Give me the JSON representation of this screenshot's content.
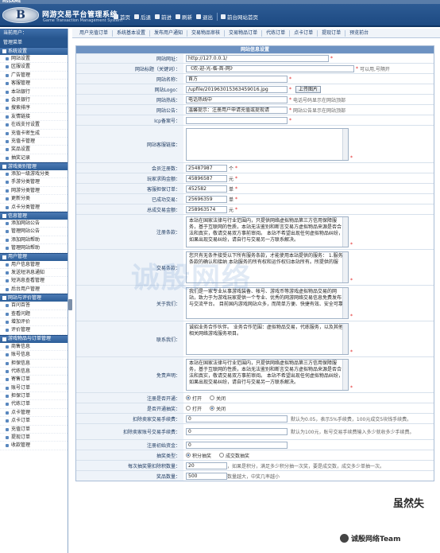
{
  "window_title": "HSSAME",
  "header": {
    "logo_text": "B",
    "system_name": "网游交易平台管理系统",
    "system_name_en": "Game Transaction Management System",
    "nav": [
      {
        "label": "首页",
        "icon": "home-icon"
      },
      {
        "label": "后退",
        "icon": "back-icon"
      },
      {
        "label": "前进",
        "icon": "forward-icon"
      },
      {
        "label": "刷新",
        "icon": "refresh-icon"
      },
      {
        "label": "退出",
        "icon": "logout-icon"
      },
      {
        "label": "前台网站首页",
        "icon": "site-home-icon"
      }
    ]
  },
  "sidebar": {
    "current_user_label": "当前用户：",
    "admin_label": "管理菜单",
    "groups": [
      {
        "title": "系统设置",
        "items": [
          "网站设置",
          "区服设置",
          "广告管理",
          "客服管理",
          "本站银行",
          "会员银行",
          "搜索排序",
          "友情链接",
          "在线支付设置",
          "充值卡密生成",
          "充值卡管理",
          "奖品设置",
          "抽奖记录"
        ]
      },
      {
        "title": "游戏类别管理",
        "items": [
          "添加一级游戏分类",
          "手游分类管理",
          "网游分类管理",
          "更新分类",
          "点卡分类管理"
        ]
      },
      {
        "title": "信息管理",
        "items": [
          "添加网站公告",
          "管理网站公告",
          "添加网站帮助",
          "管理网站帮助"
        ]
      },
      {
        "title": "用户管理",
        "items": [
          "用户信息管理",
          "发送短消息通知",
          "短消息查看管理",
          "后台用户管理"
        ]
      },
      {
        "title": "网站与评价管理",
        "items": [
          "百问百答",
          "查看问题",
          "增加评价",
          "评价管理"
        ]
      },
      {
        "title": "游戏物品与订单管理",
        "items": [
          "商售信息",
          "账号信息",
          "担保信息",
          "代练信息",
          "寄售订单",
          "账号订单",
          "担保订单",
          "代练订单",
          "点卡管理",
          "点卡订单",
          "充值订单",
          "提现订单",
          "收款管理"
        ]
      }
    ]
  },
  "tabs": [
    "用户充值订单",
    "系统基本设置",
    "发布用户通知",
    "交易物品审核",
    "交易物品订单",
    "代练订单",
    "点卡订单",
    "提现订单",
    "预览前台"
  ],
  "form": {
    "title": "网站信息设置",
    "rows": [
      {
        "label": "网站网址：",
        "value": "http://127.0.0.1/",
        "required": true,
        "hint": ""
      },
      {
        "label": "网站标题（关键词）：",
        "value": "《欢-迎-光-临-首-网》",
        "required": true,
        "hint": "可以用,号隔开"
      },
      {
        "label": "网站名称：",
        "value": "首方",
        "required": true,
        "hint": ""
      },
      {
        "label": "网站Logo：",
        "value": "/upfile/201963015363459016.jpg",
        "required": true,
        "button": "上传图片"
      },
      {
        "label": "网站热线：",
        "value": "电话热线中",
        "required": true,
        "hint": "电话号码显示在网站顶部"
      },
      {
        "label": "网站公告：",
        "value": "温馨提示：注册用户申请充值或提现请",
        "required": true,
        "hint": "网站公告显示在网站顶部"
      },
      {
        "label": "Icp备案号：",
        "value": "",
        "required": true
      }
    ],
    "service_label": "网站客服链接：",
    "stats": [
      {
        "label": "会员注册数：",
        "value": "25487987",
        "unit": "个"
      },
      {
        "label": "玩家求购金额：",
        "value": "45896587",
        "unit": "元"
      },
      {
        "label": "客服担保订单：",
        "value": "452582",
        "unit": "单"
      },
      {
        "label": "已成功交易：",
        "value": "25696359",
        "unit": "单"
      },
      {
        "label": "总成交易金额：",
        "value": "258963574",
        "unit": "元"
      }
    ],
    "texts": [
      {
        "label": "注册条款：",
        "content": "本站在国家法律与行业范围内，只提供网络虚拟物品第三方信用保障服务，基于互联网的性质，本站无法鉴别和断言交易方虚拟物品来源是否合法和真实，敬请交易双方事前审阅。  本站不希望出现任何虚拟物品纠纷，如果出现交易纠纷，请自行与交易另一方联系解决。"
      },
      {
        "label": "交易条款：",
        "content": "您只有无条件接受以下所有服务条款，才能使用本站提供的服务：  1.服务条款的确认和接纳  本站服务的所有权和运作权归本站所有。所提供的服"
      },
      {
        "label": "关于我们：",
        "content": "我们是一家专业从事游戏装备、帐号、游戏币等游戏虚拟物品交易的网站，致力于为游戏玩家提供一个专业、优秀的网游网络交易信息免费发布与交流平台。  目前国内游戏网站众多，而简单方便、快捷有效、安全可靠"
      },
      {
        "label": "联系我们：",
        "content": "诚招业务合作伙伴。  业务合作范围：虚拟物品交易，代练服务，以及其他相关网络游戏服务项目。"
      },
      {
        "label": "免责声明：",
        "content": "本站在国家法律与行业范围内，只提供网络虚拟物品第三方信用保障服务，基于互联网的性质，本站无法鉴别和断言交易方虚拟物品来源是否合法和真实，敬请交易双方事前审阅。  本站不希望出现任何虚拟物品纠纷，如果出现交易纠纷，请自行与交易另一方联系解决。"
      }
    ],
    "radios": [
      {
        "label": "注册是否开通：",
        "options": [
          "打开",
          "关闭"
        ],
        "selected": 0
      },
      {
        "label": "是否开通抽奖：",
        "options": [
          "打开",
          "关闭"
        ],
        "selected": 1
      }
    ],
    "fees": [
      {
        "label": "扣除卖家交易手续费：",
        "value": "0",
        "hint": "默认为0.05，表示5%手续费，100元成交5块钱手续费。"
      },
      {
        "label": "扣除卖家账号交易手续费：",
        "value": "0",
        "hint": "默认为100元，账号交易手续费输入多少就收多少手续费。"
      },
      {
        "label": "注册初始资金：",
        "value": "0",
        "hint": ""
      }
    ],
    "draw_mode": {
      "label": "抽奖类型：",
      "options": [
        "积分抽奖",
        "成交数抽奖"
      ],
      "selected": 0
    },
    "tail": [
      {
        "label": "每次抽奖需扣除积数量：",
        "value": "20",
        "hint": "，如果是积分，满足多少积分抽一次奖，要是成交数，成交多少单抽一次。"
      },
      {
        "label": "奖品数量：",
        "value": "500",
        "hint": "数量越大，中奖几率越小"
      }
    ]
  },
  "watermarks": {
    "center": "诚殷网络",
    "corner1": "虽然失",
    "corner2": "诚殷网络Team"
  }
}
